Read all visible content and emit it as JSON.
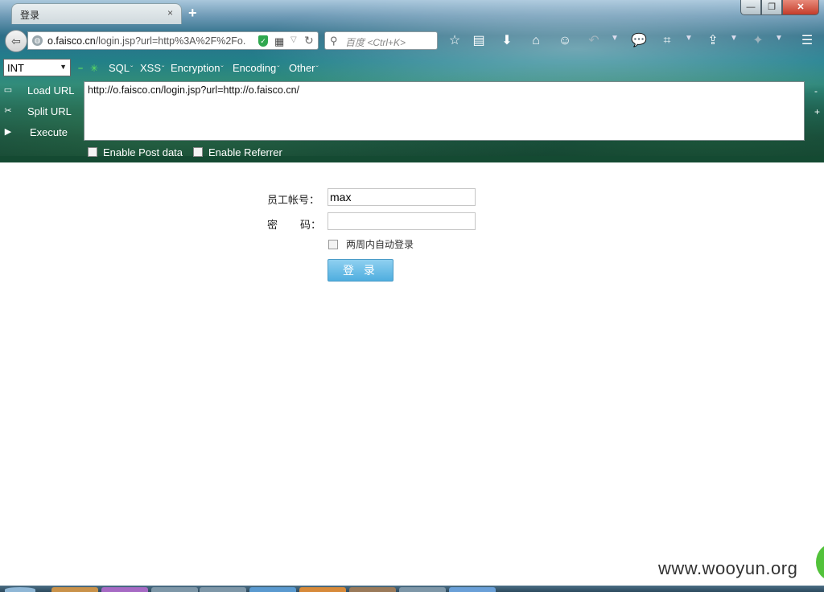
{
  "browser": {
    "tab_title": "登录",
    "tab_close": "×",
    "new_tab": "+",
    "window": {
      "minimize": "—",
      "maximize": "❐",
      "close": "✕"
    },
    "url_prefix_host": "o.faisco.cn",
    "url_rest": "/login.jsp?url=http%3A%2F%2Fo.",
    "search_placeholder": "百度 <Ctrl+K>",
    "toolbar_icons": [
      "bookmark-star-icon",
      "reading-list-icon",
      "download-icon",
      "home-icon",
      "smiley-icon",
      "undo-icon",
      "chat-icon",
      "crop-icon",
      "upload-icon",
      "extension-icon",
      "menu-icon"
    ]
  },
  "hackbar": {
    "select_value": "INT",
    "menus": [
      "SQL",
      "XSS",
      "Encryption",
      "Encoding",
      "Other"
    ],
    "commands": {
      "load": "Load URL",
      "split": "Split URL",
      "execute": "Execute"
    },
    "url_value": "http://o.faisco.cn/login.jsp?url=http://o.faisco.cn/",
    "side_minus": "-",
    "side_plus": "+",
    "enable_post": "Enable Post data",
    "enable_referrer": "Enable Referrer"
  },
  "login": {
    "account_label": "员工帐号：",
    "account_value": "max",
    "password_label_1": "密",
    "password_label_2": "码：",
    "password_value": "",
    "remember_label": "两周内自动登录",
    "submit_label": "登 录"
  },
  "watermark": "www.wooyun.org"
}
